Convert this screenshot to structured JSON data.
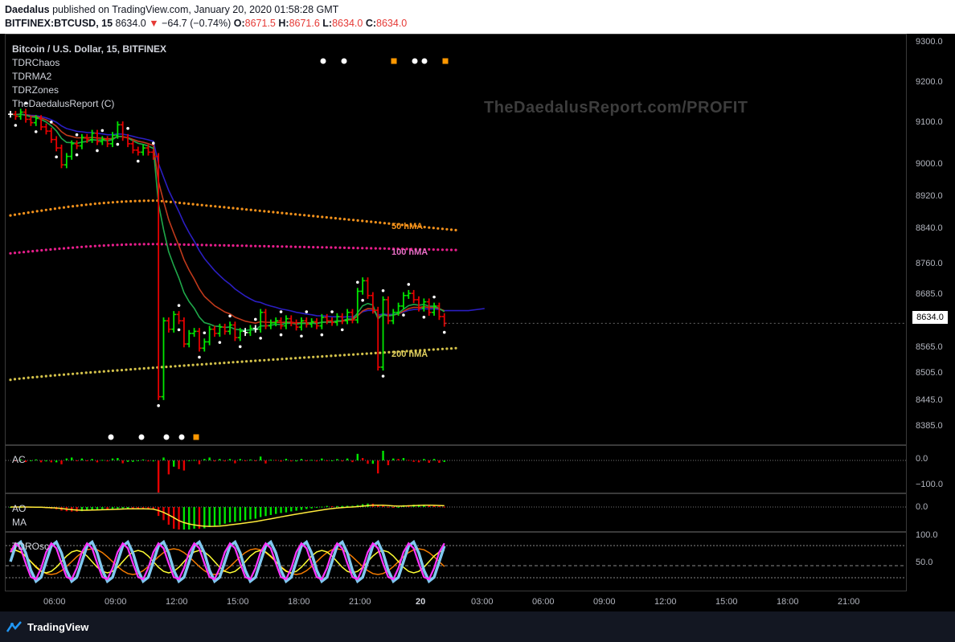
{
  "header": {
    "publisher": "Daedalus",
    "published_text": "published on TradingView.com, January 20, 2020 01:58:28 GMT",
    "symbol": "BITFINEX:BTCUSD, 15",
    "last": "8634.0",
    "change_arrow": "▼",
    "change": "−64.7 (−0.74%)",
    "o_label": "O:",
    "o_value": "8671.5",
    "h_label": "H:",
    "h_value": "8671.6",
    "l_label": "L:",
    "l_value": "8634.0",
    "c_label": "C:",
    "c_value": "8634.0"
  },
  "legend": {
    "title": "Bitcoin / U.S. Dollar, 15, BITFINEX",
    "items": [
      "TDRChaos",
      "TDRMA2",
      "TDRZones",
      "TheDaedalusReport (C)"
    ]
  },
  "watermark": "TheDaedalusReport.com/PROFIT",
  "ma_labels": {
    "ma50": "50 hMA",
    "ma100": "100 hMA",
    "ma200": "200 hMA"
  },
  "colors": {
    "up": "#00e600",
    "down": "#e60000",
    "neutral": "#ffffff",
    "ma50": "#f5921b",
    "ma100": "#e91e8c",
    "ma200": "#d4c24a",
    "fast": "#1fa84a",
    "mid": "#c0391b",
    "slow": "#2b1ec2",
    "tdr_cyan": "#7fc8f0",
    "tdr_magenta": "#ff33ff",
    "tdr_orange": "#f57c00",
    "tdr_yellow": "#ffff33",
    "ao_signal": "#ffeb3b"
  },
  "price_axis": {
    "ticks": [
      "9300.0",
      "9200.0",
      "9100.0",
      "9000.0",
      "8920.0",
      "8840.0",
      "8760.0",
      "8685.0",
      "8565.0",
      "8505.0",
      "8445.0",
      "8385.0"
    ],
    "current": "8634.0"
  },
  "time_axis": [
    "06:00",
    "09:00",
    "12:00",
    "15:00",
    "18:00",
    "21:00",
    "20",
    "03:00",
    "06:00",
    "09:00",
    "12:00",
    "15:00",
    "18:00",
    "21:00"
  ],
  "panes": {
    "ac": {
      "label": "AC",
      "ticks": [
        "0.0",
        "−100.0"
      ]
    },
    "ao": {
      "label": "AO",
      "label2": "MA",
      "ticks": [
        "0.0"
      ]
    },
    "tdr": {
      "label": "TDROsc",
      "ticks": [
        "100.0",
        "50.0"
      ]
    }
  },
  "footer": {
    "brand": "TradingView"
  },
  "chart_data": [
    {
      "type": "candlestick",
      "title": "Bitcoin / U.S. Dollar, 15, BITFINEX",
      "ylim": [
        8330,
        9330
      ],
      "x_labels": [
        "06:00",
        "09:00",
        "12:00",
        "15:00",
        "18:00",
        "21:00",
        "20",
        "03:00"
      ],
      "close_series": [
        9130,
        9125,
        9135,
        9118,
        9110,
        9120,
        9100,
        9090,
        9070,
        9050,
        9010,
        9030,
        9060,
        9055,
        9075,
        9070,
        9085,
        9065,
        9070,
        9060,
        9080,
        9105,
        9075,
        9060,
        9045,
        9040,
        9050,
        9040,
        9030,
        8460,
        8640,
        8620,
        8655,
        8640,
        8585,
        8610,
        8615,
        8575,
        8590,
        8620,
        8610,
        8625,
        8615,
        8630,
        8600,
        8615,
        8612,
        8622,
        8620,
        8660,
        8628,
        8635,
        8640,
        8628,
        8645,
        8635,
        8625,
        8640,
        8632,
        8638,
        8628,
        8648,
        8640,
        8636,
        8650,
        8640,
        8660,
        8642,
        8710,
        8735,
        8700,
        8665,
        8530,
        8690,
        8640,
        8660,
        8675,
        8700,
        8705,
        8690,
        8670,
        8685,
        8660,
        8675,
        8650,
        8634
      ],
      "moving_averages": [
        {
          "name": "50 hMA",
          "from": 8890,
          "peak": 8925,
          "to": 8855
        },
        {
          "name": "100 hMA",
          "from": 8800,
          "peak": 8822,
          "to": 8808
        },
        {
          "name": "200 hMA",
          "from": 8500,
          "to": 8575
        }
      ],
      "last_price": 8634.0
    },
    {
      "type": "bar",
      "title": "AC",
      "range": [
        -120,
        40
      ]
    },
    {
      "type": "bar",
      "title": "AO",
      "range": [
        -120,
        20
      ]
    },
    {
      "type": "line",
      "title": "TDROsc",
      "range": [
        0,
        120
      ],
      "levels": [
        100,
        50
      ]
    }
  ]
}
